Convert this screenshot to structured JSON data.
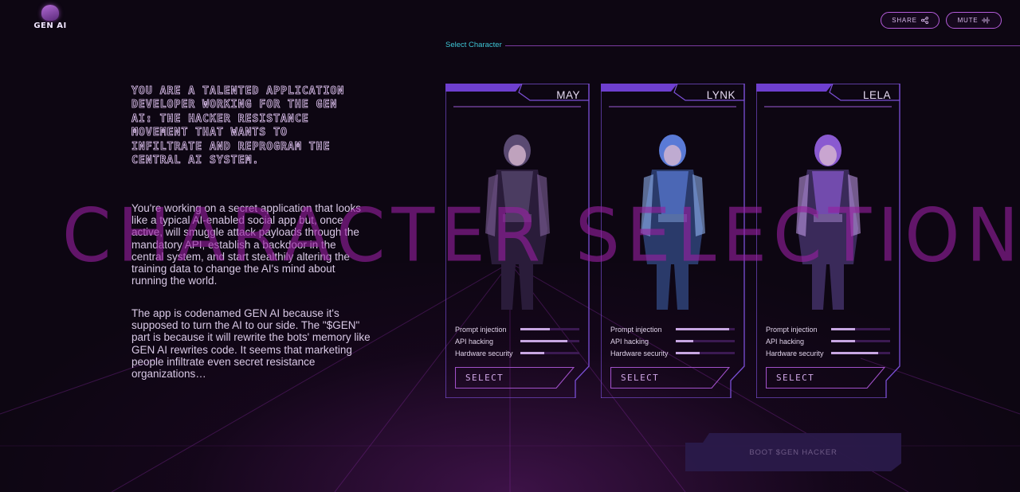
{
  "header": {
    "logo_text": "GEN AI",
    "share_label": "SHARE",
    "mute_label": "MUTE"
  },
  "section_label": "Select Character",
  "intro": {
    "headline": "You are a talented application developer working for the GEN AI: the Hacker Resistance Movement that wants to infiltrate and reprogram the central AI system.",
    "paragraph1": "You're working on a secret application that looks like a typical AI-enabled social app but, once active, will smuggle attack payloads through the mandatory API, establish a backdoor in the central system, and start stealthily altering the training data to change the AI's mind about running the world.",
    "paragraph2": "The app is codenamed GEN AI because it's supposed to turn the AI to our side. The \"$GEN\" part is because it will rewrite the bots' memory like GEN AI rewrites code. It seems that marketing people infiltrate even secret resistance organizations…"
  },
  "watermark": "CHARACTER SELECTION",
  "characters": [
    {
      "name": "MAY",
      "stats": [
        {
          "label": "Prompt injection",
          "value": 0.5
        },
        {
          "label": "API hacking",
          "value": 0.8
        },
        {
          "label": "Hardware security",
          "value": 0.4
        }
      ],
      "select_label": "SELECT"
    },
    {
      "name": "LYNK",
      "stats": [
        {
          "label": "Prompt injection",
          "value": 0.9
        },
        {
          "label": "API hacking",
          "value": 0.3
        },
        {
          "label": "Hardware security",
          "value": 0.4
        }
      ],
      "select_label": "SELECT"
    },
    {
      "name": "LELA",
      "stats": [
        {
          "label": "Prompt injection",
          "value": 0.4
        },
        {
          "label": "API hacking",
          "value": 0.4
        },
        {
          "label": "Hardware security",
          "value": 0.8
        }
      ],
      "select_label": "SELECT"
    }
  ],
  "boot_button_label": "BOOT $GEN HACKER",
  "colors": {
    "background": "#0d0612",
    "accent": "#b35bd8",
    "frame": "#7b4fd6",
    "section_label": "#3fc6d6",
    "watermark": "#961ea0"
  }
}
